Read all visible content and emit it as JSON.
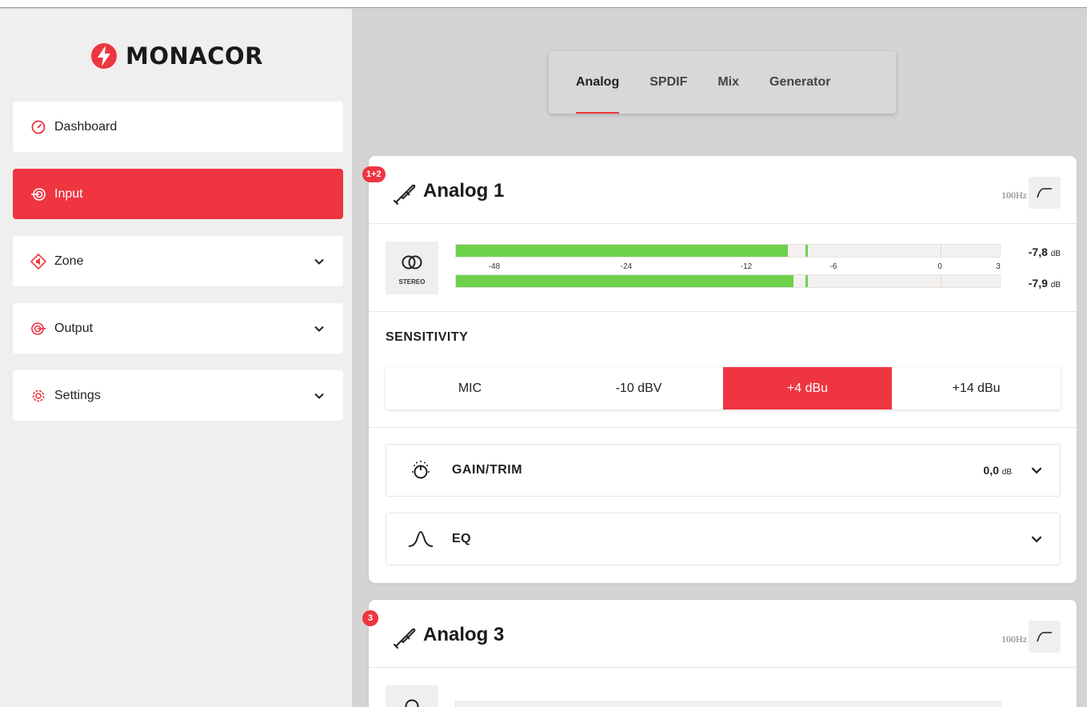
{
  "brand": {
    "name": "MONACOR"
  },
  "sidebar": {
    "items": [
      {
        "label": "Dashboard",
        "icon": "dashboard-icon",
        "expandable": false,
        "active": false
      },
      {
        "label": "Input",
        "icon": "input-icon",
        "expandable": false,
        "active": true
      },
      {
        "label": "Zone",
        "icon": "zone-icon",
        "expandable": true,
        "active": false
      },
      {
        "label": "Output",
        "icon": "output-icon",
        "expandable": true,
        "active": false
      },
      {
        "label": "Settings",
        "icon": "settings-icon",
        "expandable": true,
        "active": false
      }
    ]
  },
  "tabs": [
    {
      "label": "Analog",
      "active": true
    },
    {
      "label": "SPDIF",
      "active": false
    },
    {
      "label": "Mix",
      "active": false
    },
    {
      "label": "Generator",
      "active": false
    }
  ],
  "cards": [
    {
      "badge": "1+2",
      "title": "Analog 1",
      "hpf_label": "100Hz",
      "stereo_label": "STEREO",
      "meter": {
        "scale": [
          "-48",
          "-24",
          "-12",
          "-6",
          "0",
          "3"
        ],
        "channels": [
          {
            "level_fraction": 0.61,
            "peak_fraction": 0.643,
            "value": "-7,8",
            "unit": "dB"
          },
          {
            "level_fraction": 0.62,
            "peak_fraction": 0.643,
            "value": "-7,9",
            "unit": "dB"
          }
        ]
      },
      "sensitivity": {
        "label": "SENSITIVITY",
        "options": [
          "MIC",
          "-10 dBV",
          "+4 dBu",
          "+14 dBu"
        ],
        "selected": "+4 dBu"
      },
      "gain": {
        "label": "GAIN/TRIM",
        "value": "0,0",
        "unit": "dB"
      },
      "eq": {
        "label": "EQ"
      }
    },
    {
      "badge": "3",
      "title": "Analog 3",
      "hpf_label": "100Hz"
    }
  ],
  "colors": {
    "accent": "#ee3540",
    "meter_green": "#6dd14a",
    "background": "#d4d4d4",
    "sidebar": "#efefef"
  }
}
